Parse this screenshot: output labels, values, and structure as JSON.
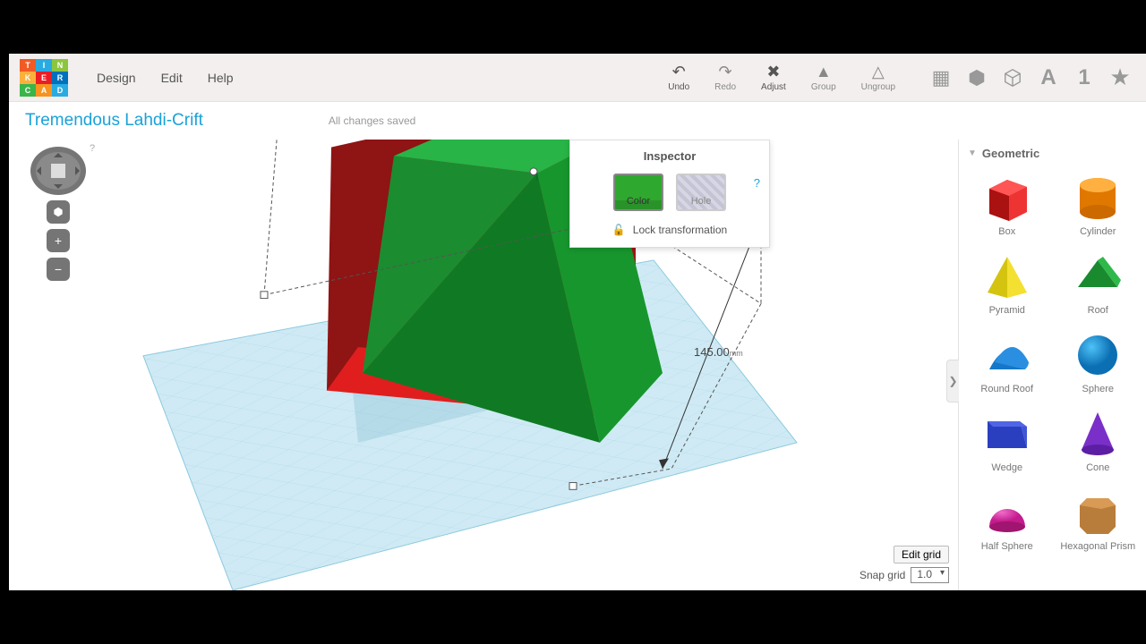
{
  "app": {
    "name": "Tinkercad"
  },
  "project": {
    "name": "Tremendous Lahdi-Crift",
    "status": "All changes saved"
  },
  "menus": {
    "design": "Design",
    "edit": "Edit",
    "help": "Help"
  },
  "tools": {
    "undo": "Undo",
    "redo": "Redo",
    "adjust": "Adjust",
    "group": "Group",
    "ungroup": "Ungroup"
  },
  "inspector": {
    "title": "Inspector",
    "color_label": "Color",
    "hole_label": "Hole",
    "lock": "Lock transformation",
    "help": "?"
  },
  "dimension": {
    "value": "145.00",
    "unit": "mm"
  },
  "grid": {
    "edit": "Edit grid",
    "snap_label": "Snap grid",
    "snap_value": "1.0"
  },
  "viewcube": {
    "help": "?"
  },
  "sidebar": {
    "category": "Geometric",
    "shapes": [
      {
        "name": "Box"
      },
      {
        "name": "Cylinder"
      },
      {
        "name": "Pyramid"
      },
      {
        "name": "Roof"
      },
      {
        "name": "Round Roof"
      },
      {
        "name": "Sphere"
      },
      {
        "name": "Wedge"
      },
      {
        "name": "Cone"
      },
      {
        "name": "Half Sphere"
      },
      {
        "name": "Hexagonal Prism"
      }
    ]
  }
}
